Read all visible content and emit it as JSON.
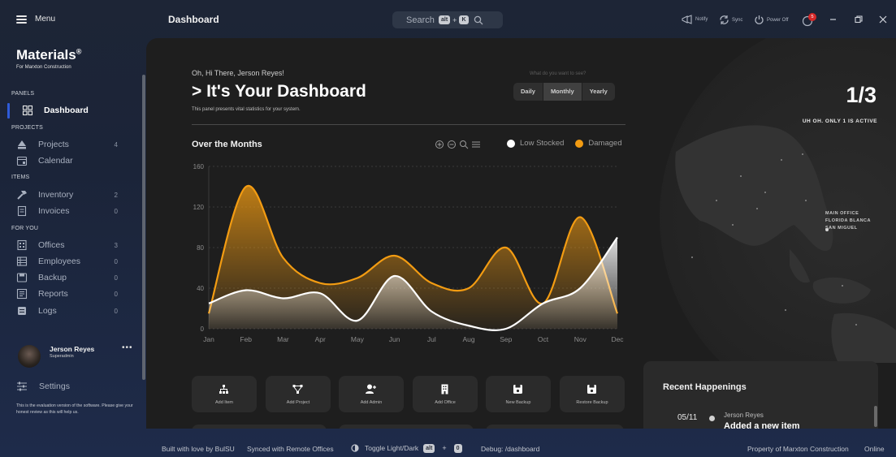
{
  "titlebar": {
    "menu_label": "Menu",
    "page_title": "Dashboard",
    "search_placeholder": "Search",
    "search_shortcut_mod": "alt",
    "search_shortcut_key": "K",
    "notify_label": "Notify",
    "sync_label": "Sync",
    "power_label": "Power Off",
    "notification_count": "5"
  },
  "sidebar": {
    "brand": "Materials",
    "brand_mark": "®",
    "brand_sub": "For Marxton Construction",
    "sections": {
      "panels": "PANELS",
      "projects": "PROJECTS",
      "items": "ITEMS",
      "for_you": "FOR YOU"
    },
    "items": [
      {
        "label": "Dashboard",
        "count": "",
        "icon": "dashboard-icon"
      },
      {
        "label": "Projects",
        "count": "4",
        "icon": "projects-icon"
      },
      {
        "label": "Calendar",
        "count": "",
        "icon": "calendar-icon"
      },
      {
        "label": "Inventory",
        "count": "2",
        "icon": "hammer-icon"
      },
      {
        "label": "Invoices",
        "count": "0",
        "icon": "invoice-icon"
      },
      {
        "label": "Offices",
        "count": "3",
        "icon": "offices-icon"
      },
      {
        "label": "Employees",
        "count": "0",
        "icon": "employees-icon"
      },
      {
        "label": "Backup",
        "count": "0",
        "icon": "backup-icon"
      },
      {
        "label": "Reports",
        "count": "0",
        "icon": "reports-icon"
      },
      {
        "label": "Logs",
        "count": "0",
        "icon": "logs-icon"
      }
    ],
    "user": {
      "name": "Jerson Reyes",
      "role": "Superadmin"
    },
    "settings_label": "Settings",
    "eval_note": "This is the evaluation version of the software. Please give your honest review as this will help us."
  },
  "main": {
    "greeting": "Oh, Hi There, Jerson Reyes!",
    "title": "> It's Your Dashboard",
    "subtitle": "This panel presents vital statistics for your system.",
    "period_question": "What do you want to see?",
    "periods": [
      "Daily",
      "Monthly",
      "Yearly"
    ],
    "selected_period": "Monthly",
    "chart_heading": "Over the Months",
    "quick_actions": [
      "Add Item",
      "Add Project",
      "Add Admin",
      "Add Office",
      "New Backup",
      "Restore Backup"
    ]
  },
  "globe": {
    "page_indicator": "1/3",
    "status": "UH OH. ONLY 1 IS ACTIVE",
    "office_label": [
      "MAIN OFFICE",
      "FLORIDA BLANCA",
      "SAN MIGUEL"
    ]
  },
  "recent": {
    "title": "Recent Happenings",
    "entries": [
      {
        "date": "05/11",
        "who": "Jerson Reyes",
        "what": "Added a new item"
      }
    ]
  },
  "footer": {
    "built": "Built with love by BulSU",
    "synced": "Synced with Remote Offices",
    "toggle": "Toggle Light/Dark",
    "toggle_mod": "alt",
    "toggle_key": "0",
    "debug": "Debug: /dashboard",
    "property": "Property of Marxton Construction",
    "status": "Online"
  },
  "colors": {
    "accent_orange": "#f39c12",
    "accent_blue": "#2f5bd8",
    "low_stocked": "#ffffff"
  },
  "chart_data": {
    "type": "area",
    "categories": [
      "Jan",
      "Feb",
      "Mar",
      "Apr",
      "May",
      "Jun",
      "Jul",
      "Aug",
      "Sep",
      "Oct",
      "Nov",
      "Dec"
    ],
    "series": [
      {
        "name": "Damaged",
        "color": "#f39c12",
        "values": [
          15,
          140,
          70,
          45,
          50,
          72,
          45,
          40,
          80,
          25,
          110,
          15
        ]
      },
      {
        "name": "Low Stocked",
        "color": "#ffffff",
        "values": [
          25,
          38,
          30,
          35,
          8,
          52,
          17,
          3,
          0,
          25,
          40,
          90
        ]
      }
    ],
    "ylim": [
      0,
      160
    ],
    "yticks": [
      0,
      40,
      80,
      120,
      160
    ],
    "grid": true,
    "legend": "top-right"
  }
}
